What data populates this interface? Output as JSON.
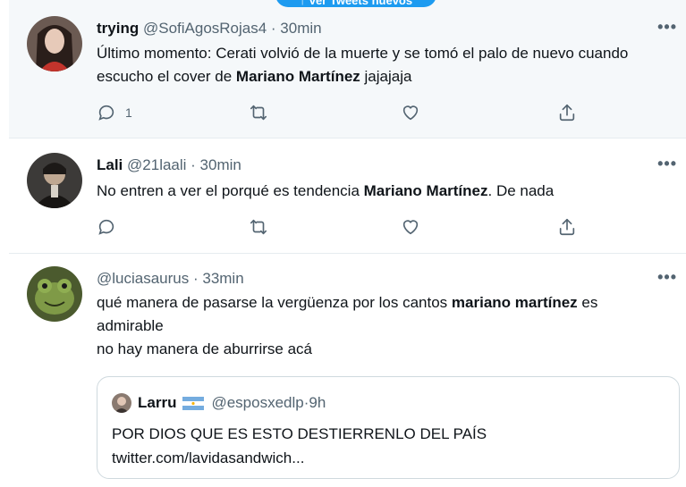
{
  "banner": {
    "label": "↑ Ver Tweets nuevos"
  },
  "tweets": [
    {
      "name": "trying",
      "handle": "@SofiAgosRojas4",
      "sep": " · ",
      "time": "30min",
      "text_parts": [
        "Último momento: Cerati volvió de la muerte y se tomó el palo de nuevo cuando escucho el cover de ",
        "Mariano Martínez",
        " jajajaja"
      ],
      "reply_count": "1"
    },
    {
      "name": "Lali",
      "handle": "@21laali",
      "sep": " · ",
      "time": "30min",
      "text_parts": [
        "No entren a ver el porqué es tendencia ",
        "Mariano Martínez",
        ". De nada"
      ],
      "reply_count": ""
    },
    {
      "name": "",
      "handle": "@luciasaurus",
      "sep": " · ",
      "time": "33min",
      "text_parts": [
        "qué manera de pasarse la vergüenza por los cantos ",
        "mariano martínez",
        " es admirable",
        "no hay manera de aburrirse acá"
      ],
      "quote": {
        "name": "Larru",
        "handle": "@esposxedlp",
        "sep": " · ",
        "time": "9h",
        "line1": "POR DIOS QUE ES ESTO DESTIERRENLO DEL PAÍS",
        "line2": "twitter.com/lavidasandwich..."
      }
    }
  ],
  "more_label": "•••",
  "colors": {
    "accent": "#1d9bf0",
    "muted": "#536471",
    "text": "#0f1419",
    "highlight_bg": "#f5f8fa",
    "border": "#e6ecf0"
  },
  "icons": {
    "reply": "reply-icon",
    "retweet": "retweet-icon",
    "like": "heart-icon",
    "share": "share-icon",
    "more": "more-icon",
    "flag": "argentina-flag-icon"
  }
}
